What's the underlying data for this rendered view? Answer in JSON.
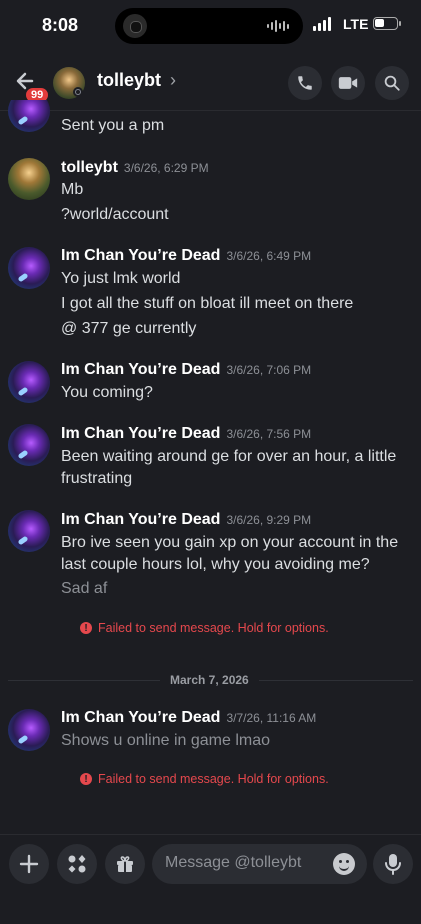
{
  "status_bar": {
    "time": "8:08",
    "network": "LTE"
  },
  "header": {
    "badge_count": "99",
    "name": "tolleybt",
    "chevron": "›"
  },
  "messages": {
    "top_line": "Sent you a pm",
    "groups": [
      {
        "author": "tolleybt",
        "timestamp": "3/6/26, 6:29 PM",
        "lines": [
          "Mb",
          "?world/account"
        ]
      },
      {
        "author": "Im Chan You’re Dead",
        "timestamp": "3/6/26, 6:49 PM",
        "lines": [
          "Yo just lmk world",
          "I got all the stuff on bloat ill meet on there",
          "@ 377 ge currently"
        ]
      },
      {
        "author": "Im Chan You’re Dead",
        "timestamp": "3/6/26, 7:06 PM",
        "lines": [
          "You coming?"
        ]
      },
      {
        "author": "Im Chan You’re Dead",
        "timestamp": "3/6/26, 7:56 PM",
        "lines": [
          "Been waiting around ge for over an hour, a little",
          "frustrating"
        ]
      },
      {
        "author": "Im Chan You’re Dead",
        "timestamp": "3/6/26, 9:29 PM",
        "lines": [
          "Bro ive seen you gain xp on your account in the",
          "last couple hours lol, why you avoiding me?",
          "Sad af"
        ]
      },
      {
        "author": "Im Chan You’re Dead",
        "timestamp": "3/7/26, 11:16 AM",
        "lines": [
          "Shows u online in game lmao"
        ]
      }
    ],
    "failed_text": "Failed to send message. Hold for options.",
    "date_divider": "March 7, 2026"
  },
  "composer": {
    "placeholder": "Message @tolleybt"
  },
  "icons": {
    "back": "arrow-left-icon",
    "call": "phone-icon",
    "video": "video-camera-icon",
    "search": "search-icon",
    "add": "plus-icon",
    "apps": "apps-icon",
    "gift": "gift-icon",
    "emoji": "emoji-icon",
    "mic": "microphone-icon"
  },
  "colors": {
    "background": "#1c1d22",
    "error": "#e5484d",
    "badge": "#e23c3c"
  }
}
